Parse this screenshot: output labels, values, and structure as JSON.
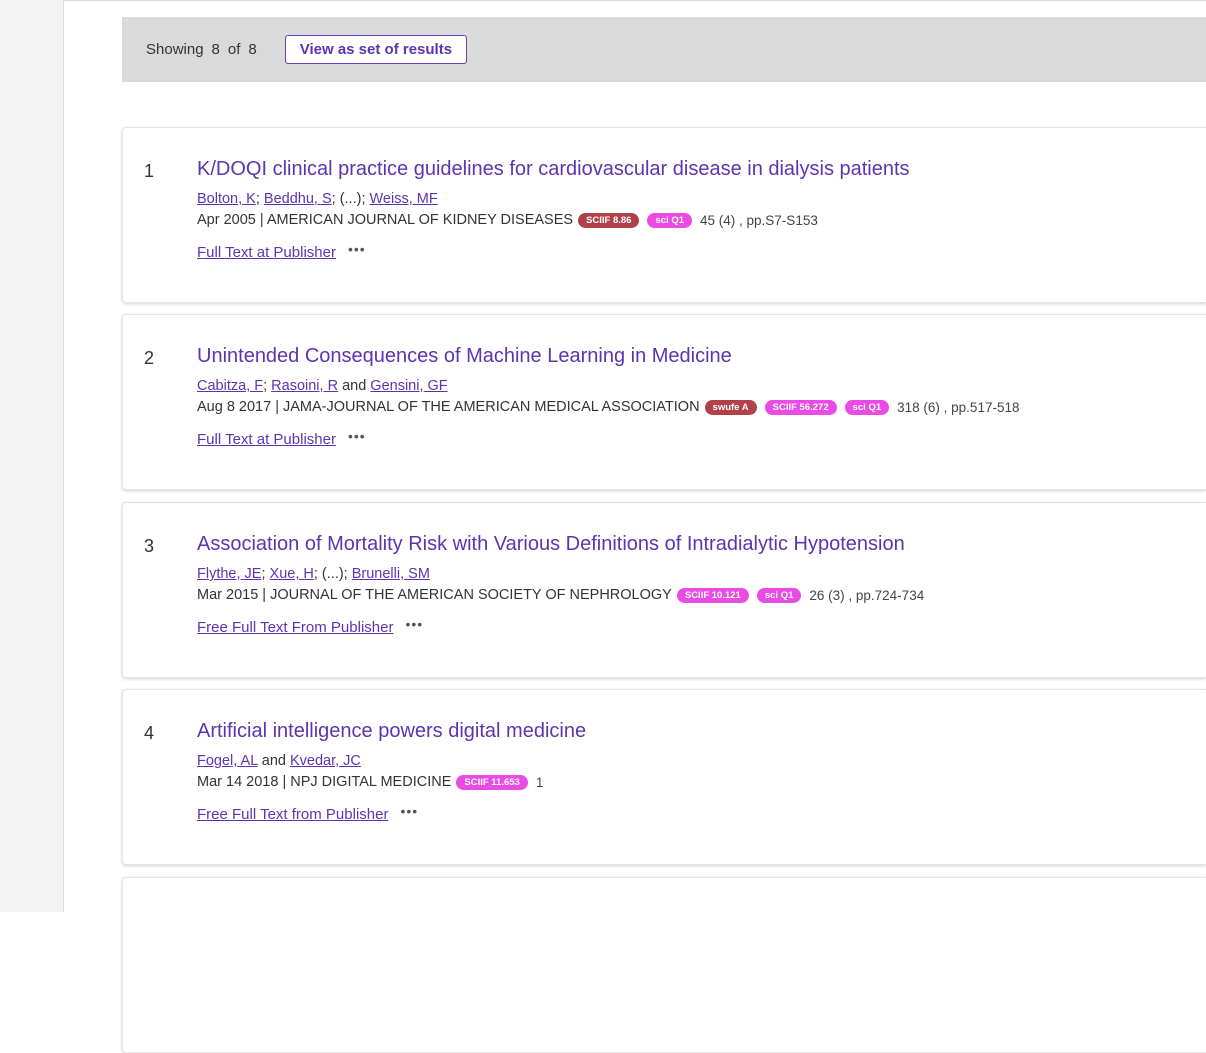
{
  "summary": {
    "showing_label": "Showing",
    "shown_count": "8",
    "of_label": "of",
    "total_count": "8",
    "view_set_button": "View as set of results"
  },
  "records": [
    {
      "index": "1",
      "title": "K/DOQI clinical practice guidelines for cardiovascular disease in dialysis patients",
      "authors": [
        {
          "type": "link",
          "text": "Bolton, K"
        },
        {
          "type": "text",
          "text": "; "
        },
        {
          "type": "link",
          "text": "Beddhu, S"
        },
        {
          "type": "text",
          "text": "; (...); "
        },
        {
          "type": "link",
          "text": "Weiss, MF"
        }
      ],
      "source": "Apr 2005 | AMERICAN JOURNAL OF KIDNEY DISEASES",
      "badges": [
        {
          "text": "SCIIF 8.86",
          "style": "dark"
        },
        {
          "text": "sci Q1",
          "style": "pink"
        }
      ],
      "volume": "45 (4) , pp.S7-S153",
      "fulltext_link": "Full Text at Publisher",
      "more_icon": "•••"
    },
    {
      "index": "2",
      "title": "Unintended Consequences of Machine Learning in Medicine",
      "authors": [
        {
          "type": "link",
          "text": "Cabitza, F"
        },
        {
          "type": "text",
          "text": "; "
        },
        {
          "type": "link",
          "text": "Rasoini, R"
        },
        {
          "type": "text",
          "text": " and "
        },
        {
          "type": "link",
          "text": "Gensini, GF"
        }
      ],
      "source": "Aug 8 2017 | JAMA-JOURNAL OF THE AMERICAN MEDICAL ASSOCIATION",
      "badges": [
        {
          "text": "swufe A",
          "style": "dark"
        },
        {
          "text": "SCIIF 56.272",
          "style": "pink"
        },
        {
          "text": "sci Q1",
          "style": "pink"
        }
      ],
      "volume": "318 (6) , pp.517-518",
      "fulltext_link": "Full Text at Publisher",
      "more_icon": "•••"
    },
    {
      "index": "3",
      "title": "Association of Mortality Risk with Various Definitions of Intradialytic Hypotension",
      "authors": [
        {
          "type": "link",
          "text": "Flythe, JE"
        },
        {
          "type": "text",
          "text": "; "
        },
        {
          "type": "link",
          "text": "Xue, H"
        },
        {
          "type": "text",
          "text": "; (...); "
        },
        {
          "type": "link",
          "text": "Brunelli, SM"
        }
      ],
      "source": "Mar 2015 | JOURNAL OF THE AMERICAN SOCIETY OF NEPHROLOGY",
      "badges": [
        {
          "text": "SCIIF 10.121",
          "style": "pink"
        },
        {
          "text": "sci Q1",
          "style": "pink"
        }
      ],
      "volume": "26 (3) , pp.724-734",
      "fulltext_link": "Free Full Text From Publisher",
      "more_icon": "•••"
    },
    {
      "index": "4",
      "title": "Artificial intelligence powers digital medicine",
      "authors": [
        {
          "type": "link",
          "text": "Fogel, AL"
        },
        {
          "type": "text",
          "text": " and "
        },
        {
          "type": "link",
          "text": "Kvedar, JC"
        }
      ],
      "source": "Mar 14 2018 | NPJ DIGITAL MEDICINE",
      "badges": [
        {
          "text": "SCIIF 11.653",
          "style": "pink"
        }
      ],
      "volume": "1",
      "fulltext_link": "Free Full Text from Publisher",
      "more_icon": "•••"
    }
  ],
  "colors": {
    "accent": "#5b35b0",
    "badge_dark": "#b0414a",
    "badge_pink": "#e94be4",
    "summary_bg": "#dadada"
  }
}
